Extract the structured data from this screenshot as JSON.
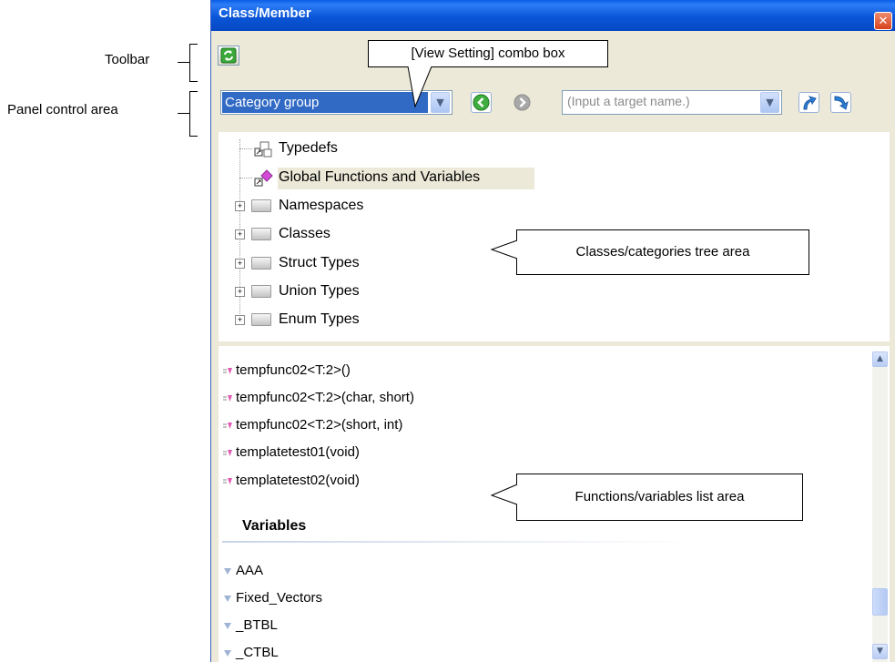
{
  "window": {
    "title": "Class/Member",
    "close_glyph": "✕"
  },
  "annotations": {
    "toolbar": "Toolbar",
    "panel_control": "Panel control area",
    "view_setting": "[View Setting] combo box",
    "tree_area": "Classes/categories tree area",
    "list_area": "Functions/variables list area"
  },
  "control": {
    "view_setting_value": "Category group",
    "target_placeholder": "(Input a target name.)"
  },
  "tree": {
    "items": [
      {
        "label": "Typedefs",
        "icon": "typedef-icon"
      },
      {
        "label": "Global Functions and Variables",
        "icon": "global-functions-icon"
      },
      {
        "label": "Namespaces",
        "icon": "folder-icon"
      },
      {
        "label": "Classes",
        "icon": "folder-icon"
      },
      {
        "label": "Struct Types",
        "icon": "folder-icon"
      },
      {
        "label": "Union Types",
        "icon": "folder-icon"
      },
      {
        "label": "Enum Types",
        "icon": "folder-icon"
      }
    ]
  },
  "list": {
    "functions": [
      "tempfunc02<T:2>()",
      "tempfunc02<T:2>(char, short)",
      "tempfunc02<T:2>(short, int)",
      "templatetest01(void)",
      "templatetest02(void)"
    ],
    "variables_heading": "Variables",
    "variables": [
      "AAA",
      "Fixed_Vectors",
      "_BTBL",
      "_CTBL"
    ]
  },
  "colors": {
    "titlebar": "#0a55d8",
    "selection": "#316ac5",
    "highlight": "#ece9d8"
  }
}
